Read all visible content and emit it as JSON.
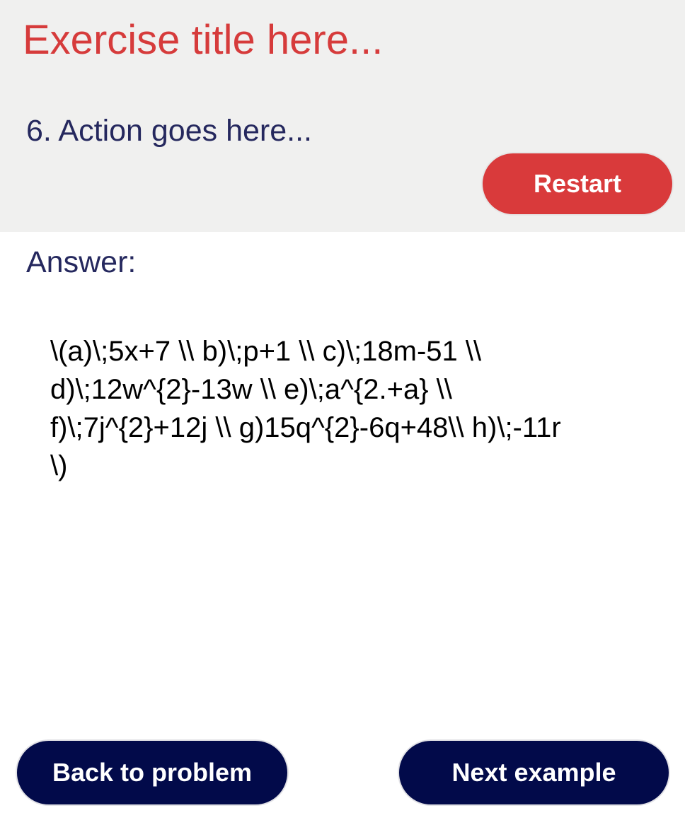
{
  "header": {
    "title": "Exercise title here...",
    "action": "6. Action goes here...",
    "restart_label": "Restart"
  },
  "answer": {
    "label": "Answer:",
    "lines": [
      "\\(a)\\;5x+7 \\\\ b)\\;p+1 \\\\ c)\\;18m-51 \\\\",
      "d)\\;12w^{2}-13w \\\\ e)\\;a^{2.+a} \\\\",
      "f)\\;7j^{2}+12j \\\\ g)15q^{2}-6q+48\\\\ h)\\;-11r",
      "\\)"
    ]
  },
  "footer": {
    "back_label": "Back to problem",
    "next_label": "Next example"
  },
  "colors": {
    "title_red": "#d63b3b",
    "restart_red": "#d93a3b",
    "nav_navy": "#020a4a",
    "text_navy": "#25285e",
    "header_bg": "#f0f0ef"
  }
}
